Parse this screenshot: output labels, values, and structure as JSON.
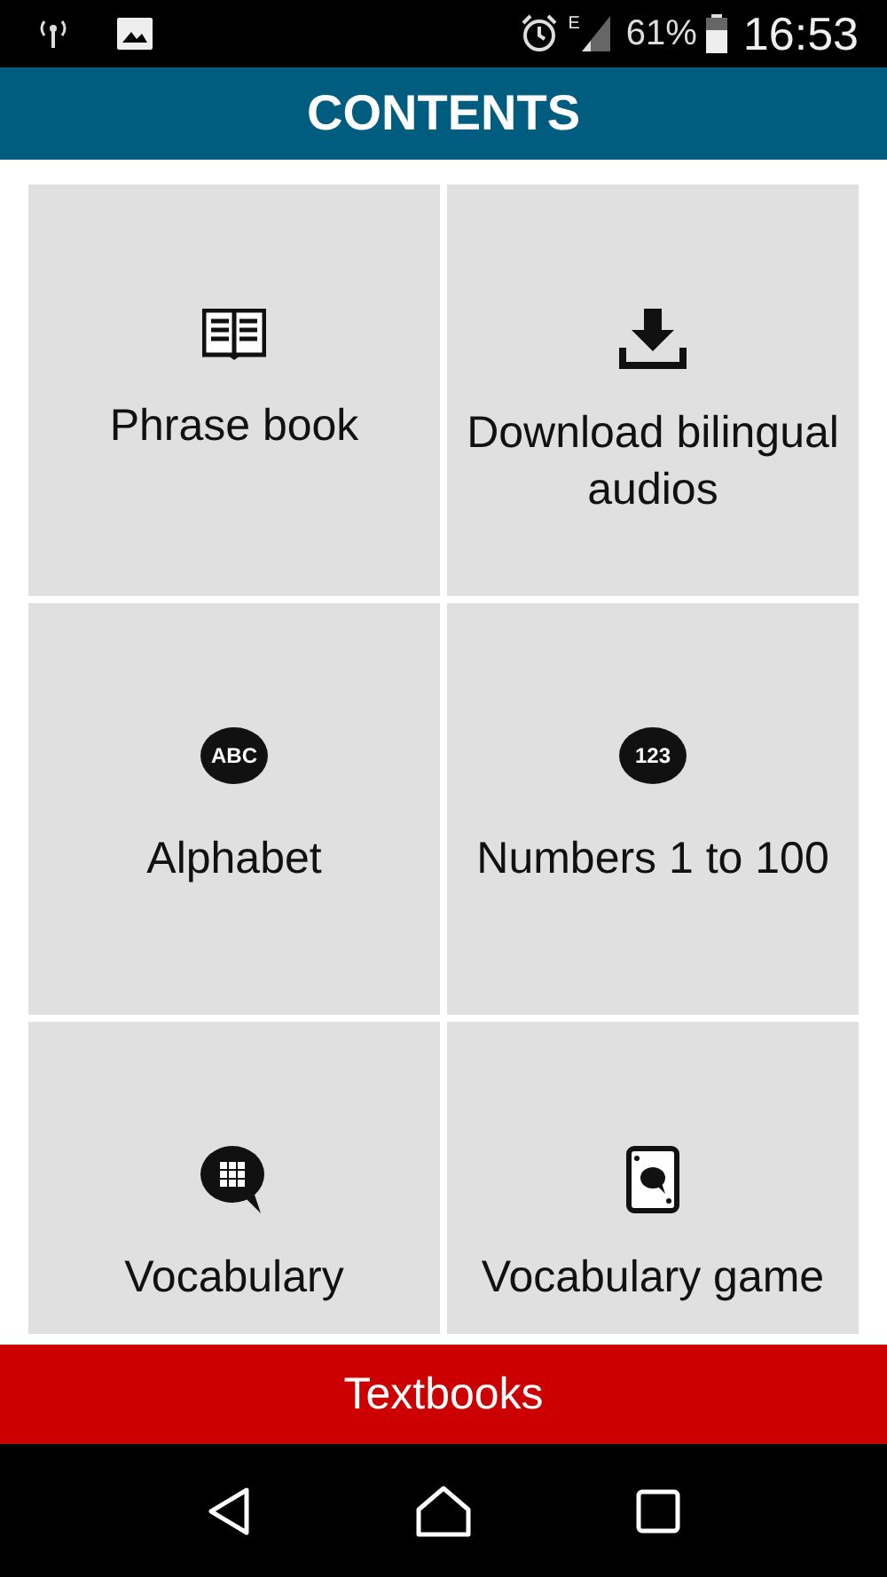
{
  "status_bar": {
    "network_type": "E",
    "battery": "61%",
    "time": "16:53"
  },
  "header": {
    "title": "CONTENTS"
  },
  "tiles": [
    {
      "kind": "book",
      "label": "Phrase book"
    },
    {
      "kind": "download",
      "label": "Download bilingual audios"
    },
    {
      "kind": "bubble",
      "icon_text": "ABC",
      "label": "Alphabet"
    },
    {
      "kind": "bubble",
      "icon_text": "123",
      "label": "Numbers 1 to 100"
    },
    {
      "kind": "grid-bubble",
      "label": "Vocabulary"
    },
    {
      "kind": "card",
      "label": "Vocabulary game"
    }
  ],
  "bottom_button": {
    "label": "Textbooks"
  }
}
